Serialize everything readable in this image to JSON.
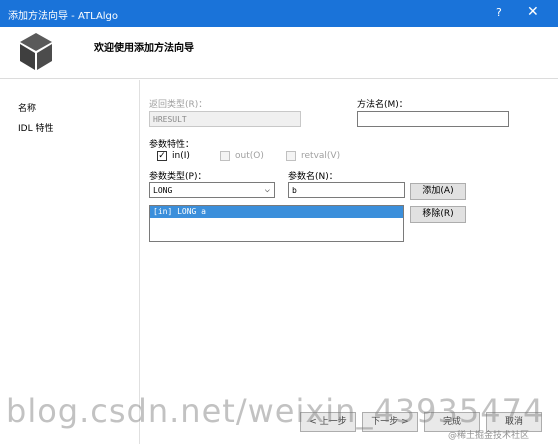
{
  "window": {
    "title": "添加方法向导 - ATLAlgo",
    "help": "?",
    "close": "✕"
  },
  "header": {
    "welcome": "欢迎使用添加方法向导"
  },
  "sidebar": {
    "items": [
      {
        "label": "名称"
      },
      {
        "label": "IDL 特性"
      }
    ]
  },
  "form": {
    "return_type_label": "返回类型(R)：",
    "return_type_value": "HRESULT",
    "method_name_label": "方法名(M)：",
    "method_name_value": "",
    "param_attr_label": "参数特性：",
    "checkboxes": [
      {
        "label": "in(I)",
        "checked": true,
        "enabled": true
      },
      {
        "label": "out(O)",
        "checked": false,
        "enabled": false
      },
      {
        "label": "retval(V)",
        "checked": false,
        "enabled": false
      }
    ],
    "param_type_label": "参数类型(P)：",
    "param_type_value": "LONG",
    "param_name_label": "参数名(N)：",
    "param_name_value": "b",
    "add_button": "添加(A)",
    "remove_button": "移除(R)",
    "params": [
      "[in] LONG a"
    ]
  },
  "footer": {
    "prev": "< 上一步",
    "next": "下一步 >",
    "finish": "完成",
    "cancel": "取消"
  },
  "watermark": "blog.csdn.net/weixin_43935474",
  "credit": "@稀土掘金技术社区"
}
